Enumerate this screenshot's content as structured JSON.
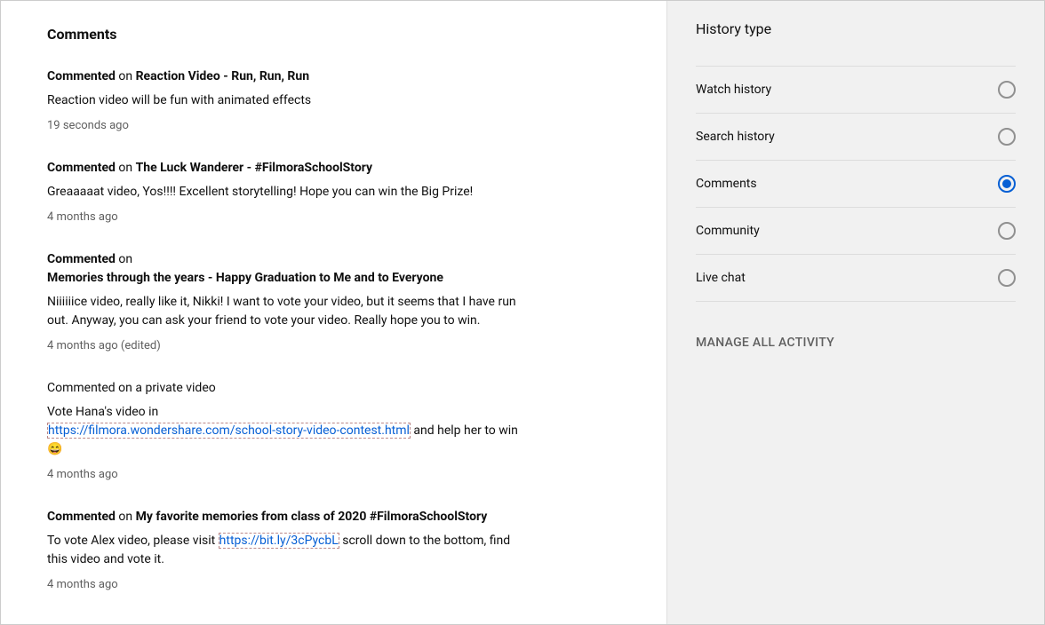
{
  "main": {
    "title": "Comments",
    "comments": [
      {
        "prefix": "Commented",
        "on": " on ",
        "video": "Reaction Video - Run, Run, Run",
        "text": "Reaction video will be fun with animated effects",
        "time": "19 seconds ago"
      },
      {
        "prefix": "Commented",
        "on": " on ",
        "video": "The Luck Wanderer - #FilmoraSchoolStory",
        "text": "Greaaaaat video, Yos!!!! Excellent storytelling! Hope you can win the Big Prize!",
        "time": "4 months ago"
      },
      {
        "prefix": "Commented",
        "on": " on",
        "video": "Memories through the years - Happy Graduation to Me and to Everyone",
        "text": "Niiiiiice video, really like it, Nikki! I want to vote your video, but it seems that I have run out. Anyway, you can ask your friend to vote your video. Really hope you to win.",
        "time": "4 months ago (edited)"
      },
      {
        "prefix": "Commented on a private video",
        "text_before": "Vote Hana's video in ",
        "link": "https://filmora.wondershare.com/school-story-video-contest.html",
        "text_after": " and help her to win 😄",
        "time": "4 months ago"
      },
      {
        "prefix": "Commented",
        "on": " on ",
        "video": "My favorite memories from class of 2020 #FilmoraSchoolStory",
        "text_before": "To vote Alex video, please visit ",
        "link": "https://bit.ly/3cPycbL",
        "text_after": " scroll down to the bottom, find this video and vote it.",
        "time": "4 months ago"
      }
    ]
  },
  "sidebar": {
    "title": "History type",
    "items": [
      {
        "label": "Watch history",
        "selected": false
      },
      {
        "label": "Search history",
        "selected": false
      },
      {
        "label": "Comments",
        "selected": true
      },
      {
        "label": "Community",
        "selected": false
      },
      {
        "label": "Live chat",
        "selected": false
      }
    ],
    "manage": "MANAGE ALL ACTIVITY"
  }
}
